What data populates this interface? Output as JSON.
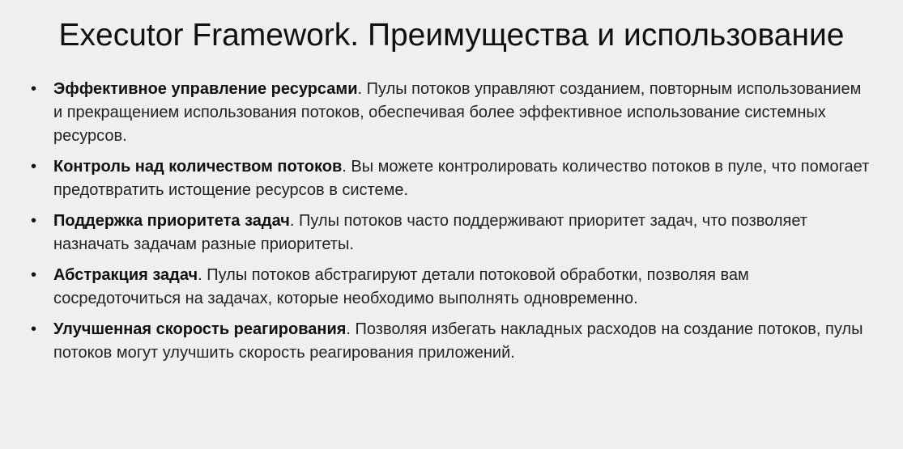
{
  "slide": {
    "title": "Executor Framework. Преимущества и использование",
    "bullet_symbol": "•",
    "bullets": [
      {
        "heading": "Эффективное управление ресурсами",
        "text": ". Пулы потоков управляют созданием, повторным использованием и прекращением использования потоков, обеспечивая более эффективное использование системных ресурсов."
      },
      {
        "heading": "Контроль над количеством потоков",
        "text": ". Вы можете контролировать количество потоков в пуле, что помогает предотвратить истощение ресурсов в системе."
      },
      {
        "heading": "Поддержка приоритета задач",
        "text": ". Пулы потоков часто поддерживают приоритет задач, что позволяет назначать задачам разные приоритеты."
      },
      {
        "heading": "Абстракция задач",
        "text": ". Пулы потоков абстрагируют детали потоковой обработки, позволяя вам сосредоточиться на задачах, которые необходимо выполнять одновременно."
      },
      {
        "heading": "Улучшенная скорость реагирования",
        "text": ". Позволяя избегать накладных расходов на создание потоков, пулы потоков могут улучшить скорость реагирования приложений."
      }
    ]
  }
}
